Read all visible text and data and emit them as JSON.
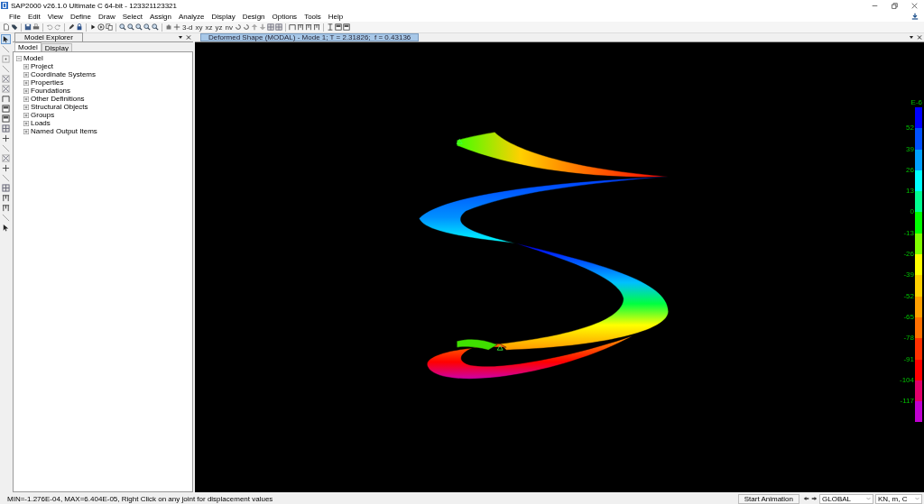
{
  "window": {
    "title": "SAP2000 v26.1.0 Ultimate C 64-bit - 123321123321"
  },
  "menu": [
    "File",
    "Edit",
    "View",
    "Define",
    "Draw",
    "Select",
    "Assign",
    "Analyze",
    "Display",
    "Design",
    "Options",
    "Tools",
    "Help"
  ],
  "toolbar": {
    "view_buttons": [
      "3-d",
      "xy",
      "xz",
      "yz",
      "nv"
    ]
  },
  "explorer": {
    "title": "Model Explorer",
    "tabs": [
      {
        "label": "Model",
        "selected": true
      },
      {
        "label": "Display",
        "selected": false
      }
    ],
    "tree": [
      {
        "label": "Model",
        "expanded": true,
        "children": [
          {
            "label": "Project",
            "expanded": false
          },
          {
            "label": "Coordinate Systems",
            "expanded": false
          },
          {
            "label": "Properties",
            "expanded": false
          },
          {
            "label": "Foundations",
            "expanded": false
          },
          {
            "label": "Other Definitions",
            "expanded": false
          },
          {
            "label": "Structural Objects",
            "expanded": false
          },
          {
            "label": "Groups",
            "expanded": false
          },
          {
            "label": "Loads",
            "expanded": false
          },
          {
            "label": "Named Output Items",
            "expanded": false
          }
        ]
      }
    ]
  },
  "viewport": {
    "title": "Deformed Shape (MODAL) - Mode 1; T = 2.31826;  f = 0.43136",
    "legend": {
      "unit": "E-6",
      "segments": [
        {
          "color": "#0000ff"
        },
        {
          "color": "#0050ff"
        },
        {
          "color": "#00a0ff"
        },
        {
          "color": "#00ffff"
        },
        {
          "color": "#00ff90"
        },
        {
          "color": "#00ff00"
        },
        {
          "color": "#80ff00"
        },
        {
          "color": "#ffff00"
        },
        {
          "color": "#ffd000"
        },
        {
          "color": "#ffa000"
        },
        {
          "color": "#ff7000"
        },
        {
          "color": "#ff3000"
        },
        {
          "color": "#ff0000"
        },
        {
          "color": "#e0006a"
        },
        {
          "color": "#c000d0"
        }
      ],
      "labels": [
        "52",
        "39",
        "26",
        "13",
        "0",
        "-13",
        "-26",
        "-39",
        "-52",
        "-65",
        "-78",
        "-91",
        "-104",
        "-117"
      ]
    }
  },
  "status_bar": {
    "message": "MIN=-1.276E-04, MAX=6.404E-05, Right Click on any joint for displacement values",
    "animation_button": "Start Animation",
    "coordinate_system": "GLOBAL",
    "units": "KN, m, C"
  }
}
